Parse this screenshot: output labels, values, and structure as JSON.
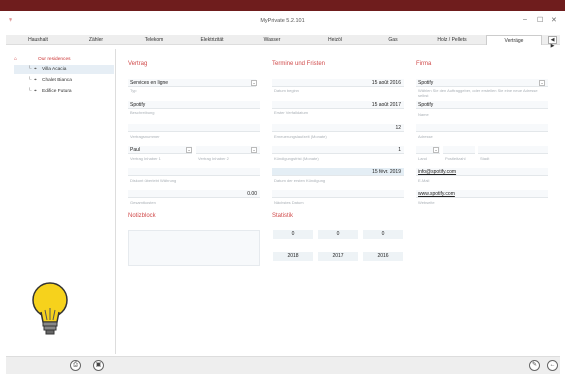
{
  "window": {
    "title": "MyPrivate 5.2.101",
    "controls": [
      "–",
      "☐",
      "✕"
    ]
  },
  "tabs": [
    {
      "label": "Haushalt"
    },
    {
      "label": "Zähler"
    },
    {
      "label": "Telekom"
    },
    {
      "label": "Elektrizität"
    },
    {
      "label": "Wasser"
    },
    {
      "label": "Heizöl"
    },
    {
      "label": "Gas"
    },
    {
      "label": "Holz / Pellets"
    },
    {
      "label": "Verträge",
      "active": true
    }
  ],
  "tab_scroll": "◀ ▶",
  "sidebar": {
    "root_label": "Our residences",
    "items": [
      {
        "label": "Villa Acacia",
        "selected": true
      },
      {
        "label": "Chalet Bianca"
      },
      {
        "label": "Edifice Futura"
      }
    ]
  },
  "vertrag": {
    "title": "Vertrag",
    "typ_value": "Services en ligne",
    "typ_label": "Typ",
    "beschreibung_value": "Spotify",
    "beschreibung_label": "Beschreibung",
    "vertragsnummer_label": "Vertragsnummer",
    "inhaber1_value": "Paul",
    "inhaber1_label": "Vertrag Inhaber 1",
    "inhaber2_label": "Vertrag Inhaber 2",
    "waehrung_label": "Diskont überlebt Währung",
    "monat_value": "0.00",
    "monat_label": "Gesamtkosten"
  },
  "termine": {
    "title": "Termine und Fristen",
    "beginn_value": "15 août 2016",
    "beginn_label": "Datum beginn",
    "ende_value": "15 août 2017",
    "ende_label": "Erster Verfalldatum",
    "laufzeit_value": "12",
    "laufzeit_label": "Erneuerungslaufzeit (Monate)",
    "kuendigung_value": "1",
    "kuendigung_label": "Kündigungsfrist (Monate)",
    "naechste_value": "15 févr. 2019",
    "naechste_label": "Datum der ersten Kündigung",
    "nächstes_label": "Nächstes Datum"
  },
  "firma": {
    "title": "Firma",
    "firma_value": "Spotify",
    "firma_hint": "Wählen Sie den Auftraggeber, oder erstellen Sie eine neue Adresse selbst",
    "name_value": "Spotify",
    "name_label": "Name",
    "adresse_label": "Adresse",
    "land_label": "Land",
    "plz_label": "Postleitzahl",
    "stadt_label": "Stadt",
    "email_value": "info@spotify.com",
    "email_label": "E-Mail",
    "web_value": "www.spotify.com",
    "web_label": "Webseite"
  },
  "notizblock": {
    "title": "Notizblock"
  },
  "statistik": {
    "title": "Statistik",
    "values": [
      "0",
      "0",
      "0"
    ],
    "years": [
      "2018",
      "2017",
      "2016"
    ]
  },
  "colors": {
    "accent": "#d04a4a",
    "topbar": "#6f1d1d"
  },
  "bottom": {
    "left_icons": [
      "print-icon",
      "save-icon"
    ],
    "right_icons": [
      "edit-icon",
      "back-icon"
    ]
  }
}
